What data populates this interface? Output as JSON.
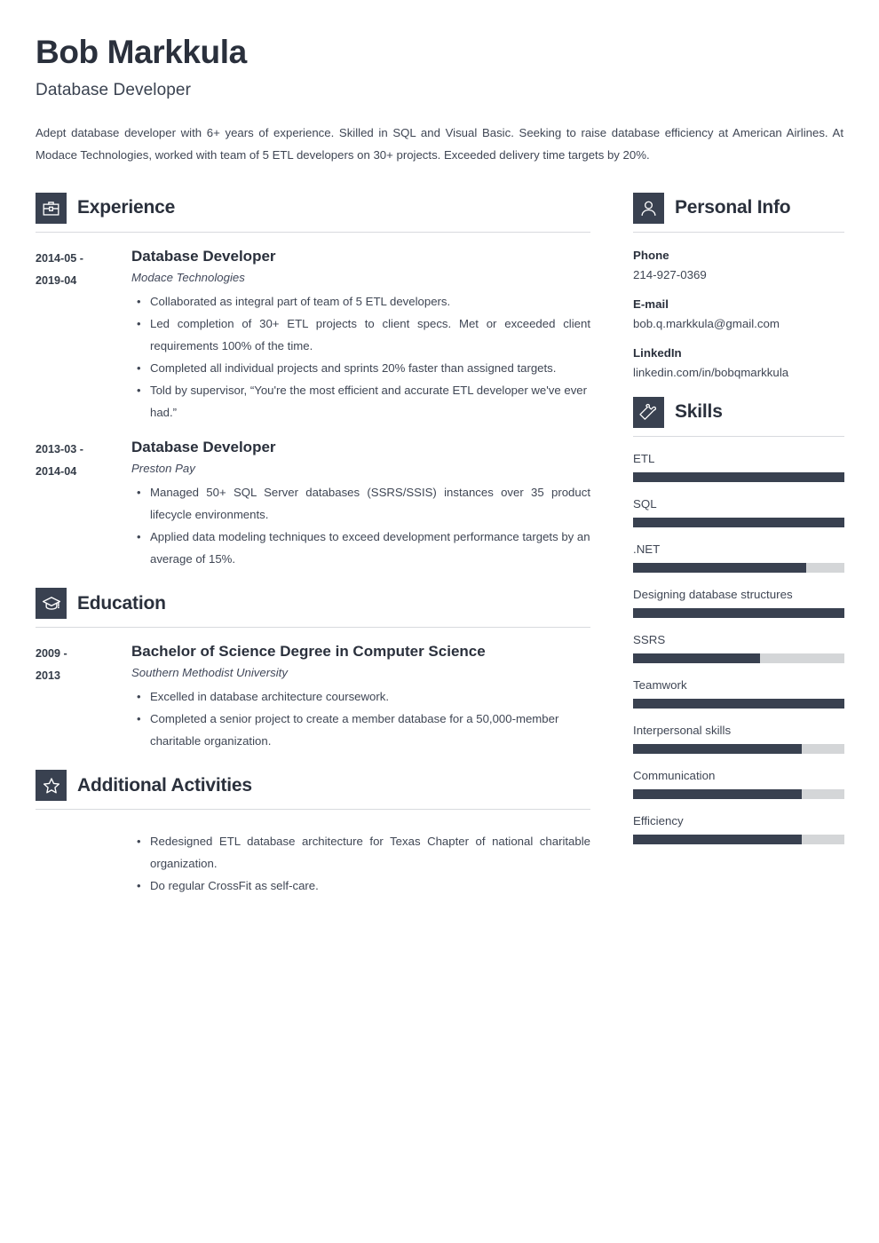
{
  "header": {
    "name": "Bob Markkula",
    "job_title": "Database Developer",
    "summary": "Adept database developer with 6+ years of experience. Skilled in SQL and Visual Basic. Seeking to raise database efficiency at American Airlines. At Modace Technologies, worked with team of 5 ETL developers on 30+ projects. Exceeded delivery time targets by 20%."
  },
  "theme": {
    "accent_dark": "#394150",
    "bar_track": "#d4d6d8",
    "rule": "#d8dade",
    "text": "#3f4654",
    "heading": "#2a303c"
  },
  "sections": {
    "experience": {
      "title": "Experience",
      "icon": "briefcase-icon",
      "entries": [
        {
          "dates": "2014-05 - 2019-04",
          "role": "Database Developer",
          "org": "Modace Technologies",
          "bullets": [
            "Collaborated as integral part of team of 5 ETL developers.",
            "Led completion of 30+ ETL projects to client specs. Met or exceeded client requirements 100% of the time.",
            "Completed all individual projects and sprints 20% faster than assigned targets.",
            "Told by supervisor, “You're the most efficient and accurate ETL developer we've ever had.”"
          ]
        },
        {
          "dates": "2013-03 - 2014-04",
          "role": "Database Developer",
          "org": "Preston Pay",
          "bullets": [
            "Managed 50+ SQL Server databases (SSRS/SSIS) instances over 35 product lifecycle environments.",
            "Applied data modeling techniques to exceed development performance targets by an average of 15%."
          ]
        }
      ]
    },
    "education": {
      "title": "Education",
      "icon": "graduation-cap-icon",
      "entries": [
        {
          "dates": "2009 - 2013",
          "role": "Bachelor of Science Degree in Computer Science",
          "org": "Southern Methodist University",
          "bullets": [
            "Excelled in database architecture coursework.",
            "Completed a senior project to create a member database for a 50,000-member charitable organization."
          ]
        }
      ]
    },
    "additional_activities": {
      "title": "Additional Activities",
      "icon": "star-icon",
      "bullets": [
        "Redesigned ETL database architecture for Texas Chapter of national charitable organization.",
        "Do regular CrossFit as self-care."
      ]
    },
    "personal_info": {
      "title": "Personal Info",
      "icon": "person-icon",
      "items": [
        {
          "label": "Phone",
          "value": "214-927-0369"
        },
        {
          "label": "E-mail",
          "value": "bob.q.markkula@gmail.com"
        },
        {
          "label": "LinkedIn",
          "value": "linkedin.com/in/bobqmarkkula"
        }
      ]
    },
    "skills": {
      "title": "Skills",
      "icon": "puzzle-piece-icon",
      "items": [
        {
          "name": "ETL",
          "level": 100
        },
        {
          "name": "SQL",
          "level": 100
        },
        {
          "name": ".NET",
          "level": 82
        },
        {
          "name": "Designing database structures",
          "level": 100
        },
        {
          "name": "SSRS",
          "level": 60
        },
        {
          "name": "Teamwork",
          "level": 100
        },
        {
          "name": "Interpersonal skills",
          "level": 80
        },
        {
          "name": "Communication",
          "level": 80
        },
        {
          "name": "Efficiency",
          "level": 80
        }
      ]
    }
  }
}
